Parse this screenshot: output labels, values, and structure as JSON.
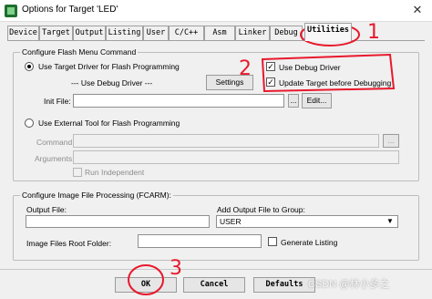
{
  "window": {
    "title": "Options for Target 'LED'",
    "close_glyph": "✕"
  },
  "tabs": [
    "Device",
    "Target",
    "Output",
    "Listing",
    "User",
    "C/C++",
    "Asm",
    "Linker",
    "Debug",
    "Utilities"
  ],
  "flash_group": {
    "title": "Configure Flash Menu Command",
    "use_target_driver_label": "Use Target Driver for Flash Programming",
    "driver_value": "--- Use Debug Driver ---",
    "settings_label": "Settings",
    "use_debug_driver_label": "Use Debug Driver",
    "update_target_label": "Update Target before Debugging",
    "init_file_label": "Init File:",
    "init_browse_label": "...",
    "edit_label": "Edit...",
    "use_external_tool_label": "Use External Tool for Flash Programming",
    "command_label": "Command:",
    "command_browse_label": "...",
    "arguments_label": "Arguments:",
    "run_independent_label": "Run Independent"
  },
  "image_group": {
    "title": "Configure Image File Processing (FCARM):",
    "output_file_label": "Output File:",
    "add_output_label": "Add Output File  to Group:",
    "group_value": "USER",
    "root_folder_label": "Image Files Root Folder:",
    "generate_listing_label": "Generate Listing"
  },
  "footer": {
    "ok_label": "OK",
    "cancel_label": "Cancel",
    "defaults_label": "Defaults"
  },
  "annotations": {
    "num1": "1",
    "num2": "2",
    "num3": "3",
    "color": "#e8192c"
  },
  "watermark": "CSDN @林小多之"
}
